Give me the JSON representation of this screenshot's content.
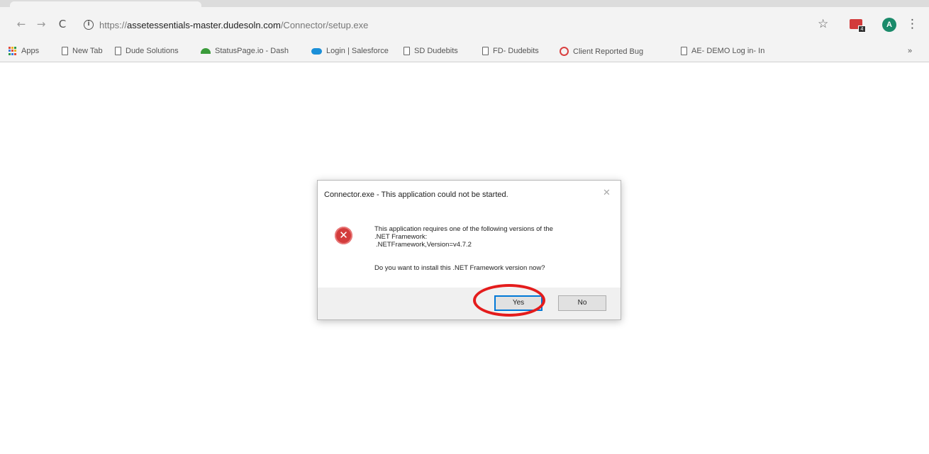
{
  "browser": {
    "url_scheme": "https://",
    "url_host": "assetessentials-master.dudesoln.com",
    "url_path": "/Connector/setup.exe",
    "avatar_letter": "A",
    "extension_badge": "4"
  },
  "bookmarks": [
    {
      "label": "Apps",
      "icon": "apps-grid-icon"
    },
    {
      "label": "New Tab",
      "icon": "page-icon"
    },
    {
      "label": "Dude Solutions",
      "icon": "page-icon"
    },
    {
      "label": "StatusPage.io - Dash",
      "icon": "statuspage-icon"
    },
    {
      "label": "Login | Salesforce",
      "icon": "salesforce-icon"
    },
    {
      "label": "SD Dudebits",
      "icon": "page-icon"
    },
    {
      "label": "FD- Dudebits",
      "icon": "page-icon"
    },
    {
      "label": "Client Reported Bug",
      "icon": "bug-icon"
    },
    {
      "label": "AE- DEMO Log in- In",
      "icon": "page-icon"
    }
  ],
  "bookmarks_overflow": "»",
  "dialog": {
    "title": "Connector.exe - This application could not be started.",
    "message_line1": "This application requires one of the following versions of the",
    "message_line2": ".NET Framework:",
    "message_line3": ".NETFramework,Version=v4.7.2",
    "question": "Do you want to install this .NET Framework version now?",
    "yes_label": "Yes",
    "no_label": "No"
  },
  "colors": {
    "highlight": "#e41c1c",
    "error": "#d33b3b",
    "avatar": "#1a8a6a"
  }
}
